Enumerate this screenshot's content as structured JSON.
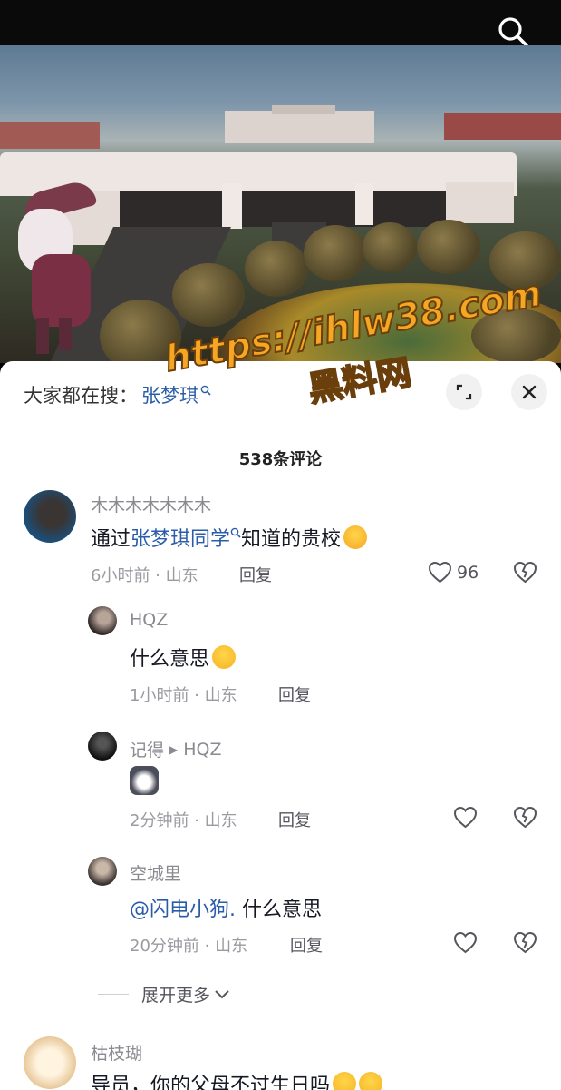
{
  "colors": {
    "link": "#2a5caa",
    "text": "#161823",
    "meta": "#9a9ba0",
    "watermark": "#f5a623"
  },
  "icons": [
    "search-icon",
    "expand-icon",
    "close-icon",
    "heart-icon",
    "broken-heart-icon",
    "chevron-down-icon"
  ],
  "trending": {
    "label": "大家都在搜：",
    "keyword": "张梦琪"
  },
  "comment_count": "538条评论",
  "comments": [
    {
      "user": "木木木木木木木",
      "text_before": "通过",
      "mention": "张梦琪同学",
      "text_after": "知道的贵校",
      "time_location": "6小时前 · 山东",
      "reply_label": "回复",
      "likes": "96"
    }
  ],
  "replies": [
    {
      "user": "HQZ",
      "text": "什么意思",
      "time_location": "1小时前 · 山东",
      "reply_label": "回复"
    },
    {
      "user": "记得",
      "reply_to": "HQZ",
      "time_location": "2分钟前 · 山东",
      "reply_label": "回复"
    },
    {
      "user": "空城里",
      "mention": "@闪电小狗.",
      "text": " 什么意思",
      "time_location": "20分钟前 · 山东",
      "reply_label": "回复"
    }
  ],
  "expand_more": "展开更多",
  "next_comment": {
    "user": "枯枝瑚",
    "text": "导员，你的父母不过生日吗"
  },
  "watermark": {
    "url": "https://ihlw38.com",
    "name": "黑料网"
  }
}
